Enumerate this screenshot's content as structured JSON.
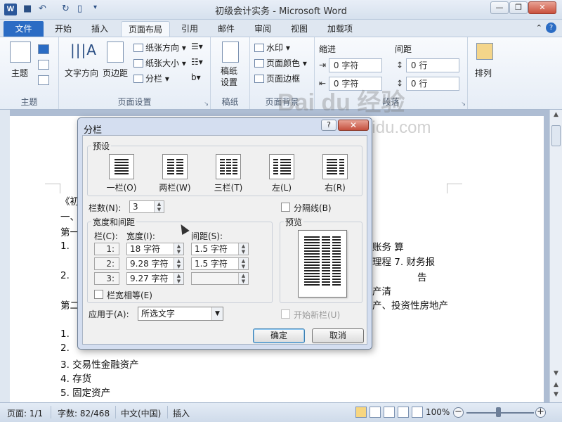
{
  "window": {
    "title": "初级会计实务 - Microsoft Word",
    "app_icon": "W",
    "controls": [
      "minimize-icon",
      "restore-icon",
      "close-icon"
    ]
  },
  "tabs": {
    "file": "文件",
    "items": [
      "开始",
      "插入",
      "页面布局",
      "引用",
      "邮件",
      "审阅",
      "视图",
      "加载项"
    ],
    "active": "页面布局"
  },
  "ribbon": {
    "theme": {
      "btn": "主题",
      "group": "主题"
    },
    "page_setup": {
      "text_direction": "文字方向",
      "margins": "页边距",
      "orientation": "纸张方向",
      "size": "纸张大小",
      "columns": "分栏",
      "group": "页面设置"
    },
    "manuscript": {
      "btn_line1": "稿纸",
      "btn_line2": "设置",
      "group": "稿纸"
    },
    "page_background": {
      "watermark": "水印",
      "page_color": "页面颜色",
      "page_border": "页面边框",
      "group": "页面背景"
    },
    "paragraph": {
      "indent_label": "缩进",
      "spacing_label": "间距",
      "indent_left": "0 字符",
      "indent_right": "0 字符",
      "spacing_before": "0 行",
      "spacing_after": "0 行",
      "group": "段落"
    },
    "arrange": {
      "btn": "排列"
    }
  },
  "document": {
    "lines": [
      "《初",
      "一、",
      "第一",
      "1.",
      "2.",
      "第二",
      "1.",
      "2.",
      "3.  交易性金融资产",
      "4.  存货",
      "5.  固定资产"
    ],
    "right_text": [
      "账务      算",
      "理程   7.   财务报",
      "告",
      "产清",
      "产、投资性房地产"
    ]
  },
  "watermark": {
    "brand": "Bai du 经验",
    "url": "jingyan.baidu.com"
  },
  "dialog": {
    "title": "分栏",
    "help": "?",
    "close": "✕",
    "presets_legend": "预设",
    "presets": [
      {
        "label": "一栏(O)",
        "cols": 1
      },
      {
        "label": "两栏(W)",
        "cols": 2
      },
      {
        "label": "三栏(T)",
        "cols": 3
      },
      {
        "label": "左(L)",
        "cols": 2
      },
      {
        "label": "右(R)",
        "cols": 2
      }
    ],
    "columns_label": "栏数(N):",
    "columns_value": "3",
    "line_between": "分隔线(B)",
    "width_spacing_legend": "宽度和间距",
    "col_header": "栏(C):",
    "width_header": "宽度(I):",
    "spacing_header": "间距(S):",
    "rows": [
      {
        "col": "1:",
        "width": "18 字符",
        "spacing": "1.5 字符"
      },
      {
        "col": "2:",
        "width": "9.28 字符",
        "spacing": "1.5 字符"
      },
      {
        "col": "3:",
        "width": "9.27 字符",
        "spacing": ""
      }
    ],
    "equal_width": "栏宽相等(E)",
    "preview_legend": "预览",
    "apply_label": "应用于(A):",
    "apply_value": "所选文字",
    "start_new_column": "开始新栏(U)",
    "ok": "确定",
    "cancel": "取消"
  },
  "status": {
    "page": "页面: 1/1",
    "words": "字数: 82/468",
    "language": "中文(中国)",
    "insert": "插入",
    "zoom": "100%"
  }
}
